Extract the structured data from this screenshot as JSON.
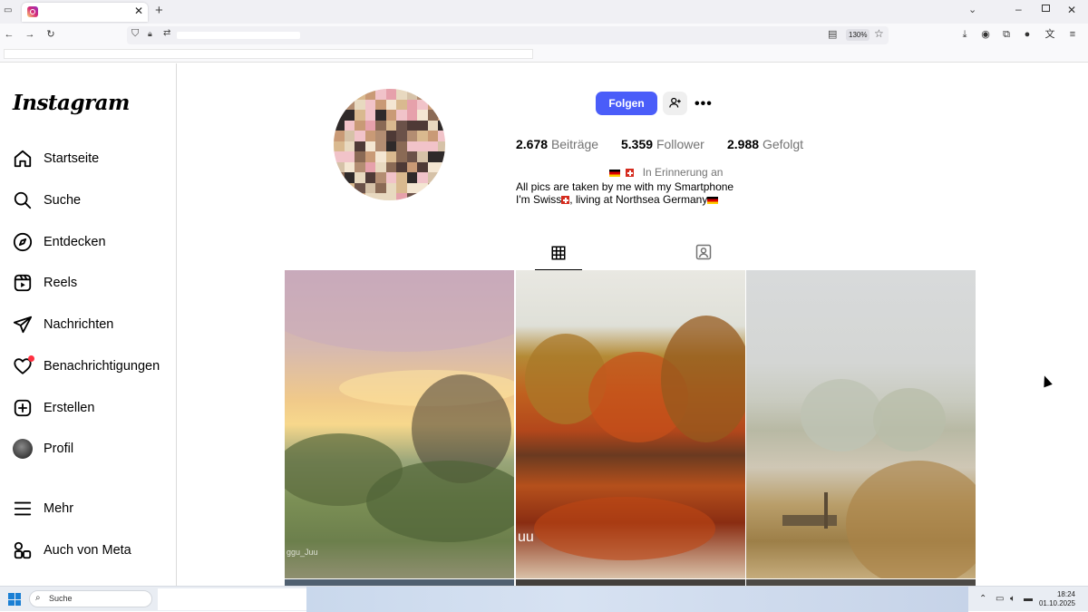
{
  "browser": {
    "tab_title": "",
    "zoom": "130%"
  },
  "sidebar": {
    "logo": "Instagram",
    "items": [
      {
        "label": "Startseite",
        "icon": "home-icon"
      },
      {
        "label": "Suche",
        "icon": "search-icon"
      },
      {
        "label": "Entdecken",
        "icon": "compass-icon"
      },
      {
        "label": "Reels",
        "icon": "reels-icon"
      },
      {
        "label": "Nachrichten",
        "icon": "send-icon"
      },
      {
        "label": "Benachrichtigungen",
        "icon": "heart-icon"
      },
      {
        "label": "Erstellen",
        "icon": "plus-square-icon"
      },
      {
        "label": "Profil",
        "icon": "avatar"
      }
    ],
    "more": {
      "label": "Mehr",
      "icon": "menu-icon"
    },
    "meta": {
      "label": "Auch von Meta",
      "icon": "meta-apps-icon"
    }
  },
  "profile": {
    "follow_label": "Folgen",
    "stats": {
      "posts_count": "2.678",
      "posts_label": "Beiträge",
      "followers_count": "5.359",
      "followers_label": "Follower",
      "following_count": "2.988",
      "following_label": "Gefolgt"
    },
    "memorial_text": "In Erinnerung an",
    "bio_line1": "All pics are taken by me with my Smartphone",
    "bio_line2_a": "I'm Swiss",
    "bio_line2_b": ", living at Northsea Germany"
  },
  "grid": {
    "captions": {
      "p1": "ggu_Juu",
      "p2": "uu"
    }
  },
  "colors": {
    "follow_button": "#4a5df9",
    "notification_dot": "#ff3040",
    "muted_text": "#737373"
  },
  "taskbar": {
    "search_label": "Suche",
    "time": "18:24",
    "date": "01.10.2025"
  }
}
